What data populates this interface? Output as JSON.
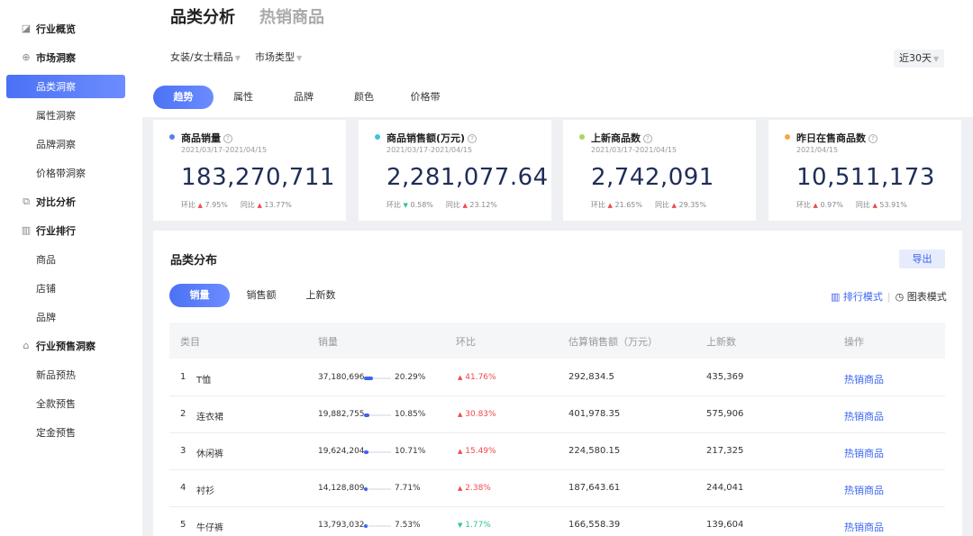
{
  "sidebar": {
    "items": [
      {
        "label": "行业概览",
        "icon": "chart-icon",
        "type": "group"
      },
      {
        "label": "市场洞察",
        "icon": "compass-icon",
        "type": "group"
      },
      {
        "label": "品类洞察",
        "type": "sub",
        "active": true
      },
      {
        "label": "属性洞察",
        "type": "sub"
      },
      {
        "label": "品牌洞察",
        "type": "sub"
      },
      {
        "label": "价格带洞察",
        "type": "sub"
      },
      {
        "label": "对比分析",
        "icon": "compare-icon",
        "type": "group"
      },
      {
        "label": "行业排行",
        "icon": "bar-chart-icon",
        "type": "group"
      },
      {
        "label": "商品",
        "type": "sub"
      },
      {
        "label": "店铺",
        "type": "sub"
      },
      {
        "label": "品牌",
        "type": "sub"
      },
      {
        "label": "行业预售洞察",
        "icon": "bag-icon",
        "type": "group"
      },
      {
        "label": "新品预热",
        "type": "sub"
      },
      {
        "label": "全款预售",
        "type": "sub"
      },
      {
        "label": "定金预售",
        "type": "sub"
      }
    ]
  },
  "header": {
    "title": "品类分析",
    "title_secondary": "热销商品",
    "filter_category": "女装/女士精品",
    "filter_market": "市场类型",
    "date_range": "近30天"
  },
  "tabs": [
    "趋势",
    "属性",
    "品牌",
    "颜色",
    "价格带"
  ],
  "cards": [
    {
      "title": "商品销量",
      "date": "2021/03/17-2021/04/15",
      "value": "183,270,711",
      "hb_label": "环比",
      "hb": "7.95%",
      "hb_dir": "up",
      "tb_label": "同比",
      "tb": "13.77%",
      "tb_dir": "up",
      "color": "#5b7cf5"
    },
    {
      "title": "商品销售额(万元)",
      "date": "2021/03/17-2021/04/15",
      "value": "2,281,077.64",
      "hb_label": "环比",
      "hb": "0.58%",
      "hb_dir": "down",
      "tb_label": "同比",
      "tb": "23.12%",
      "tb_dir": "up",
      "color": "#3ec3d5"
    },
    {
      "title": "上新商品数",
      "date": "2021/03/17-2021/04/15",
      "value": "2,742,091",
      "hb_label": "环比",
      "hb": "21.65%",
      "hb_dir": "up",
      "tb_label": "同比",
      "tb": "29.35%",
      "tb_dir": "up",
      "color": "#a6d85c"
    },
    {
      "title": "昨日在售商品数",
      "date": "2021/04/15",
      "value": "10,511,173",
      "hb_label": "环比",
      "hb": "0.97%",
      "hb_dir": "up",
      "tb_label": "同比",
      "tb": "53.91%",
      "tb_dir": "up",
      "color": "#f5a742"
    }
  ],
  "distribution": {
    "title": "品类分布",
    "export_label": "导出",
    "tabs": [
      "销量",
      "销售额",
      "上新数"
    ],
    "mode_rank": "排行模式",
    "mode_chart": "图表模式",
    "columns": [
      "类目",
      "销量",
      "环比",
      "估算销售额（万元）",
      "上新数",
      "操作"
    ],
    "rows": [
      {
        "rank": "1",
        "name": "T恤",
        "sales": "37,180,696",
        "share": "20.29%",
        "share_val": 20.29,
        "chg": "41.76%",
        "chg_dir": "up",
        "revenue": "292,834.5",
        "new_count": "435,369",
        "action": "热销商品"
      },
      {
        "rank": "2",
        "name": "连衣裙",
        "sales": "19,882,755",
        "share": "10.85%",
        "share_val": 10.85,
        "chg": "30.83%",
        "chg_dir": "up",
        "revenue": "401,978.35",
        "new_count": "575,906",
        "action": "热销商品"
      },
      {
        "rank": "3",
        "name": "休闲裤",
        "sales": "19,624,204",
        "share": "10.71%",
        "share_val": 10.71,
        "chg": "15.49%",
        "chg_dir": "up",
        "revenue": "224,580.15",
        "new_count": "217,325",
        "action": "热销商品"
      },
      {
        "rank": "4",
        "name": "衬衫",
        "sales": "14,128,809",
        "share": "7.71%",
        "share_val": 7.71,
        "chg": "2.38%",
        "chg_dir": "up",
        "revenue": "187,643.61",
        "new_count": "244,041",
        "action": "热销商品"
      },
      {
        "rank": "5",
        "name": "牛仔裤",
        "sales": "13,793,032",
        "share": "7.53%",
        "share_val": 7.53,
        "chg": "1.77%",
        "chg_dir": "down",
        "revenue": "166,558.39",
        "new_count": "139,604",
        "action": "热销商品"
      }
    ]
  }
}
